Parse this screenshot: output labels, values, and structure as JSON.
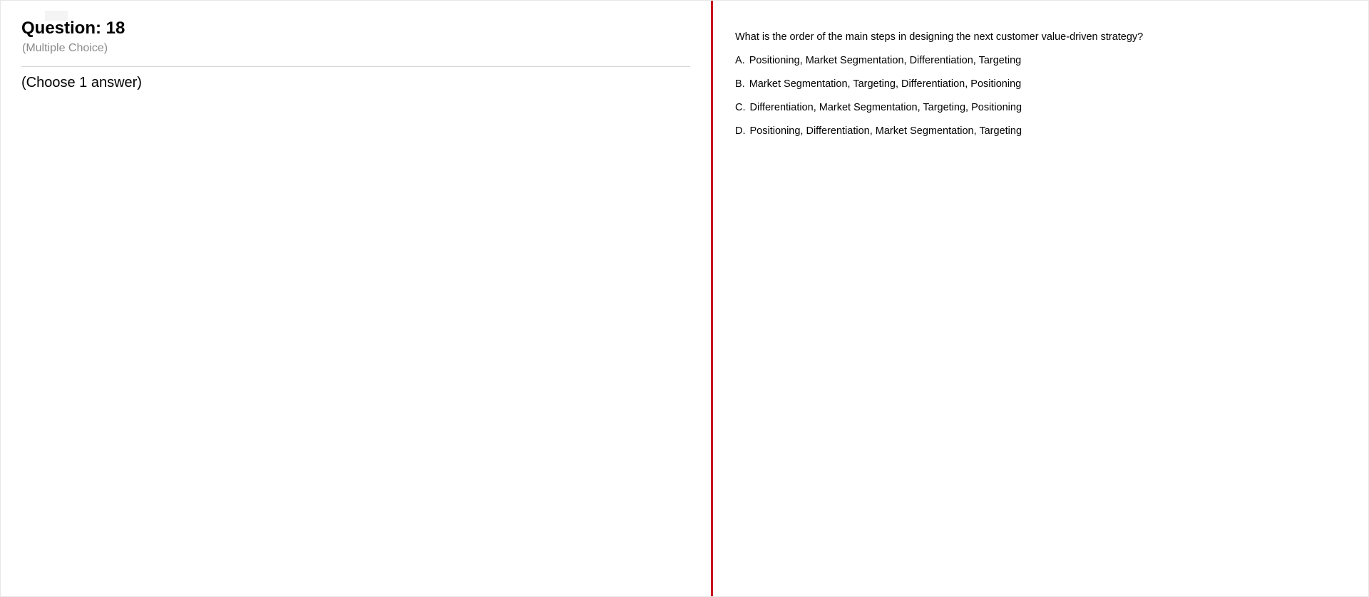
{
  "question": {
    "title": "Question: 18",
    "type": "(Multiple Choice)",
    "instruction": "(Choose 1 answer)",
    "text": "What is the order of the main steps in designing the next customer value-driven strategy?"
  },
  "options": [
    {
      "letter": "A.",
      "text": "Positioning, Market Segmentation, Differentiation, Targeting"
    },
    {
      "letter": "B.",
      "text": "Market Segmentation, Targeting, Differentiation, Positioning"
    },
    {
      "letter": "C.",
      "text": "Differentiation, Market Segmentation, Targeting, Positioning"
    },
    {
      "letter": "D.",
      "text": "Positioning, Differentiation, Market Segmentation, Targeting"
    }
  ],
  "colors": {
    "divider": "#c8141e",
    "subtitle": "#8a8a8a",
    "header_rule": "#d5d5d5"
  }
}
